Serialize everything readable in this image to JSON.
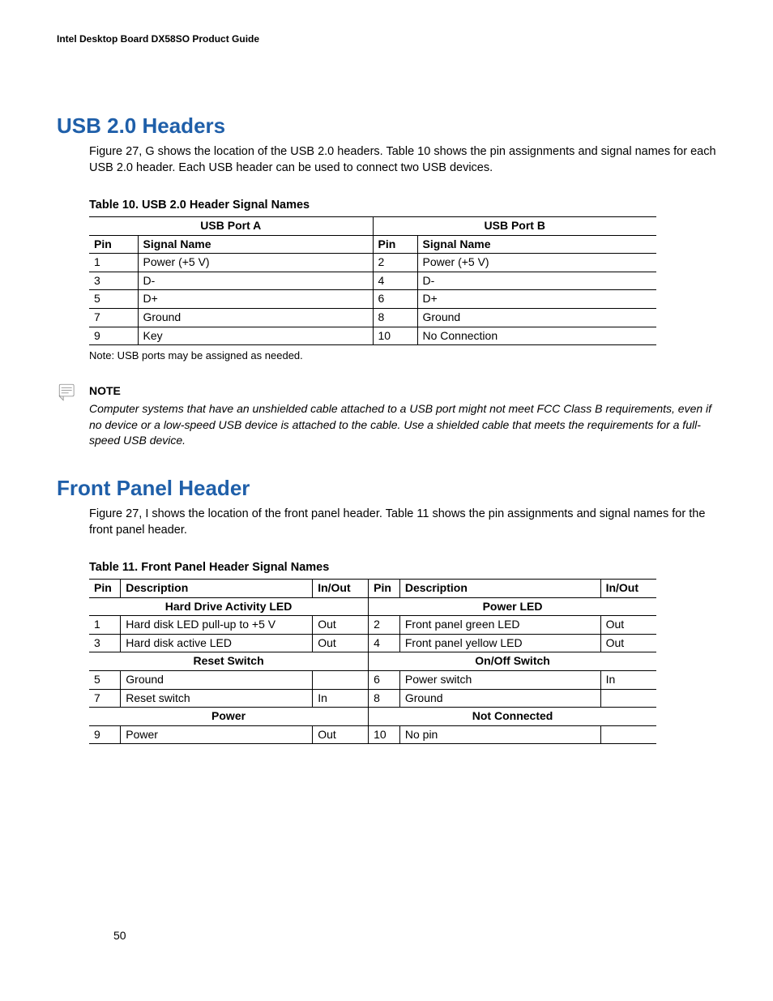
{
  "header": {
    "running": "Intel Desktop Board DX58SO Product Guide"
  },
  "page_number": "50",
  "section1": {
    "title": "USB 2.0 Headers",
    "para": "Figure 27, G shows the location of the USB 2.0 headers.  Table 10 shows the pin assignments and signal names for each USB 2.0 header.  Each USB header can be used to connect two USB devices.",
    "table_caption": "Table 10. USB 2.0 Header Signal Names",
    "table": {
      "portA_head": "USB Port A",
      "portB_head": "USB Port B",
      "col_pin": "Pin",
      "col_sig": "Signal Name",
      "rows": [
        {
          "a_pin": "1",
          "a_sig": "Power (+5 V)",
          "b_pin": "2",
          "b_sig": "Power (+5 V)"
        },
        {
          "a_pin": "3",
          "a_sig": "D-",
          "b_pin": "4",
          "b_sig": "D-"
        },
        {
          "a_pin": "5",
          "a_sig": "D+",
          "b_pin": "6",
          "b_sig": "D+"
        },
        {
          "a_pin": "7",
          "a_sig": "Ground",
          "b_pin": "8",
          "b_sig": "Ground"
        },
        {
          "a_pin": "9",
          "a_sig": "Key",
          "b_pin": "10",
          "b_sig": "No Connection"
        }
      ]
    },
    "footnote": "Note:  USB ports may be assigned as needed.",
    "note_head": "NOTE",
    "note_body": "Computer systems that have an unshielded cable attached to a USB port might not meet FCC Class B requirements, even if no device or a low-speed USB device is attached to the cable.  Use a shielded cable that meets the requirements for a full-speed USB device."
  },
  "section2": {
    "title": "Front Panel Header",
    "para": "Figure 27, I shows the location of the front panel header.  Table 11 shows the pin assignments and signal names for the front panel header.",
    "table_caption": "Table 11. Front Panel Header Signal Names",
    "table": {
      "col_pin": "Pin",
      "col_desc": "Description",
      "col_io": "In/Out",
      "groups": [
        {
          "left": "Hard Drive Activity LED",
          "right": "Power LED"
        },
        {
          "left": "Reset Switch",
          "right": "On/Off Switch"
        },
        {
          "left": "Power",
          "right": "Not Connected"
        }
      ],
      "blocks": [
        [
          {
            "l_pin": "1",
            "l_desc": "Hard disk LED pull-up to +5 V",
            "l_io": "Out",
            "r_pin": "2",
            "r_desc": "Front panel green LED",
            "r_io": "Out"
          },
          {
            "l_pin": "3",
            "l_desc": "Hard disk active LED",
            "l_io": "Out",
            "r_pin": "4",
            "r_desc": "Front panel yellow LED",
            "r_io": "Out"
          }
        ],
        [
          {
            "l_pin": "5",
            "l_desc": "Ground",
            "l_io": "",
            "r_pin": "6",
            "r_desc": "Power switch",
            "r_io": "In"
          },
          {
            "l_pin": "7",
            "l_desc": "Reset switch",
            "l_io": "In",
            "r_pin": "8",
            "r_desc": "Ground",
            "r_io": ""
          }
        ],
        [
          {
            "l_pin": "9",
            "l_desc": "Power",
            "l_io": "Out",
            "r_pin": "10",
            "r_desc": "No pin",
            "r_io": ""
          }
        ]
      ]
    }
  }
}
